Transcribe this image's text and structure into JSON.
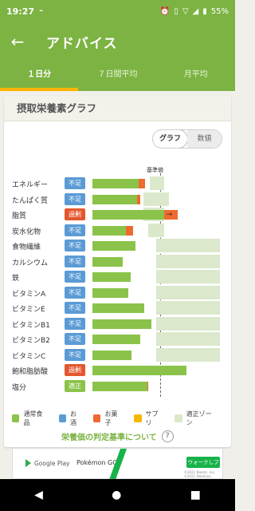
{
  "status_bar": {
    "time": "19:27",
    "left_icon": "wifi-call-icon",
    "battery": "55%"
  },
  "header": {
    "title": "アドバイス",
    "back_icon": "arrow-back-icon"
  },
  "tabs": [
    {
      "label": "１日分",
      "active": true
    },
    {
      "label": "７日間平均",
      "active": false
    },
    {
      "label": "月平均",
      "active": false
    }
  ],
  "card": {
    "title": "摂取栄養素グラフ",
    "toggle": {
      "graph": "グラフ",
      "values": "数値",
      "selected": "graph"
    },
    "reference_label": "基準値"
  },
  "nutrients": [
    {
      "name": "エネルギー",
      "status": "不足",
      "status_type": "short",
      "normal_pct": 72,
      "snack_pct": 10,
      "zone": [
        90,
        112
      ]
    },
    {
      "name": "たんぱく質",
      "status": "不足",
      "status_type": "short",
      "normal_pct": 70,
      "snack_pct": 5,
      "zone": [
        80,
        120
      ]
    },
    {
      "name": "脂質",
      "status": "過剰",
      "status_type": "over",
      "normal_pct": 112,
      "snack_pct": 22,
      "zone": [
        80,
        113
      ],
      "arrow": "→"
    },
    {
      "name": "炭水化物",
      "status": "不足",
      "status_type": "short",
      "normal_pct": 52,
      "snack_pct": 12,
      "zone": [
        87,
        112
      ]
    },
    {
      "name": "食物繊維",
      "status": "不足",
      "status_type": "short",
      "normal_pct": 67,
      "snack_pct": 0,
      "zone": [
        100,
        200
      ]
    },
    {
      "name": "カルシウム",
      "status": "不足",
      "status_type": "short",
      "normal_pct": 47,
      "snack_pct": 0,
      "zone": [
        100,
        200
      ]
    },
    {
      "name": "鉄",
      "status": "不足",
      "status_type": "short",
      "normal_pct": 60,
      "snack_pct": 0,
      "zone": [
        100,
        200
      ]
    },
    {
      "name": "ビタミンA",
      "status": "不足",
      "status_type": "short",
      "normal_pct": 56,
      "snack_pct": 0,
      "zone": [
        100,
        200
      ]
    },
    {
      "name": "ビタミンE",
      "status": "不足",
      "status_type": "short",
      "normal_pct": 81,
      "snack_pct": 0,
      "zone": [
        100,
        200
      ]
    },
    {
      "name": "ビタミンB1",
      "status": "不足",
      "status_type": "short",
      "normal_pct": 92,
      "snack_pct": 0,
      "zone": [
        100,
        200
      ]
    },
    {
      "name": "ビタミンB2",
      "status": "不足",
      "status_type": "short",
      "normal_pct": 75,
      "snack_pct": 0,
      "zone": [
        100,
        200
      ]
    },
    {
      "name": "ビタミンC",
      "status": "不足",
      "status_type": "short",
      "normal_pct": 61,
      "snack_pct": 0,
      "zone": [
        100,
        200
      ]
    },
    {
      "name": "飽和脂肪酸",
      "status": "過剰",
      "status_type": "over",
      "normal_pct": 147,
      "snack_pct": 0,
      "zone": [
        0,
        0
      ]
    },
    {
      "name": "塩分",
      "status": "適正",
      "status_type": "ok",
      "normal_pct": 86,
      "snack_pct": 2,
      "zone": [
        0,
        0
      ]
    }
  ],
  "legend": [
    {
      "label": "通常食品",
      "color": "#8bc34a"
    },
    {
      "label": "お酒",
      "color": "#5b9bd5"
    },
    {
      "label": "お菓子",
      "color": "#ee6a2f"
    },
    {
      "label": "サプリ",
      "color": "#f5b800"
    },
    {
      "label": "適正ゾーン",
      "color": "#dbe8cb"
    }
  ],
  "criteria_link": "栄養価の判定基準について",
  "help_icon": "?",
  "ad": {
    "store": "Google Play",
    "app": "Pokémon GO",
    "cta": "ウォークしプレイ",
    "fine_print": "©2021 Niantic, Inc. ©2021 Pokémon."
  },
  "nav": {
    "back": "◀",
    "home": "●",
    "recents": "■"
  }
}
